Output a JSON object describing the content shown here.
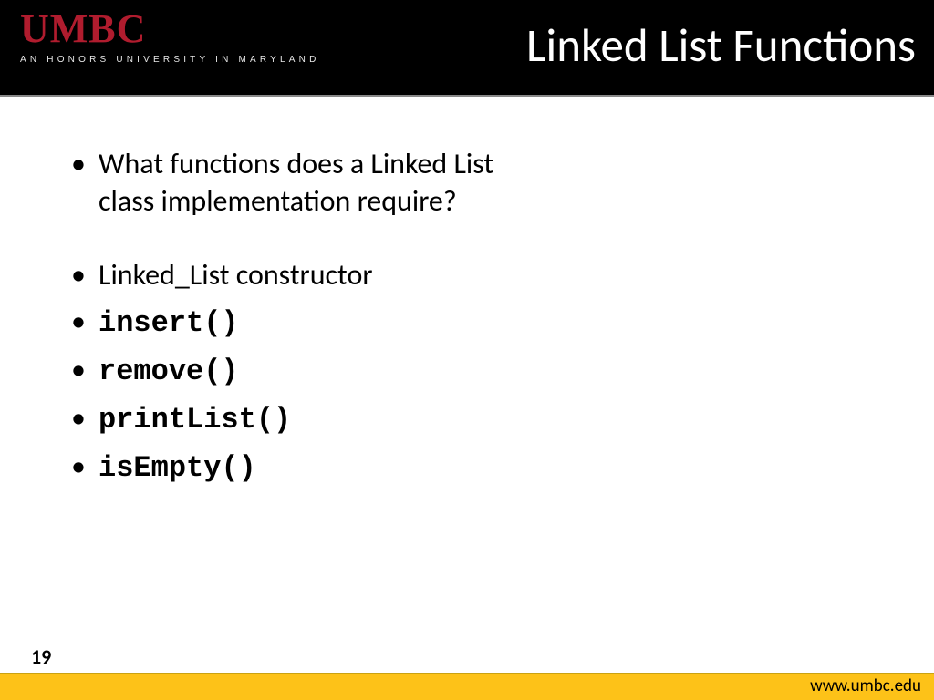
{
  "header": {
    "logo_main": "UMBC",
    "logo_sub": "AN HONORS UNIVERSITY IN MARYLAND",
    "title": "Linked List Functions"
  },
  "content": {
    "q_line1": "What functions does a Linked List",
    "q_line2": "class implementation require?",
    "items": {
      "constructor": "Linked_List constructor",
      "insert": "insert()",
      "remove": "remove()",
      "printList": "printList()",
      "isEmpty": "isEmpty()"
    }
  },
  "footer": {
    "page": "19",
    "url": "www.umbc.edu"
  }
}
